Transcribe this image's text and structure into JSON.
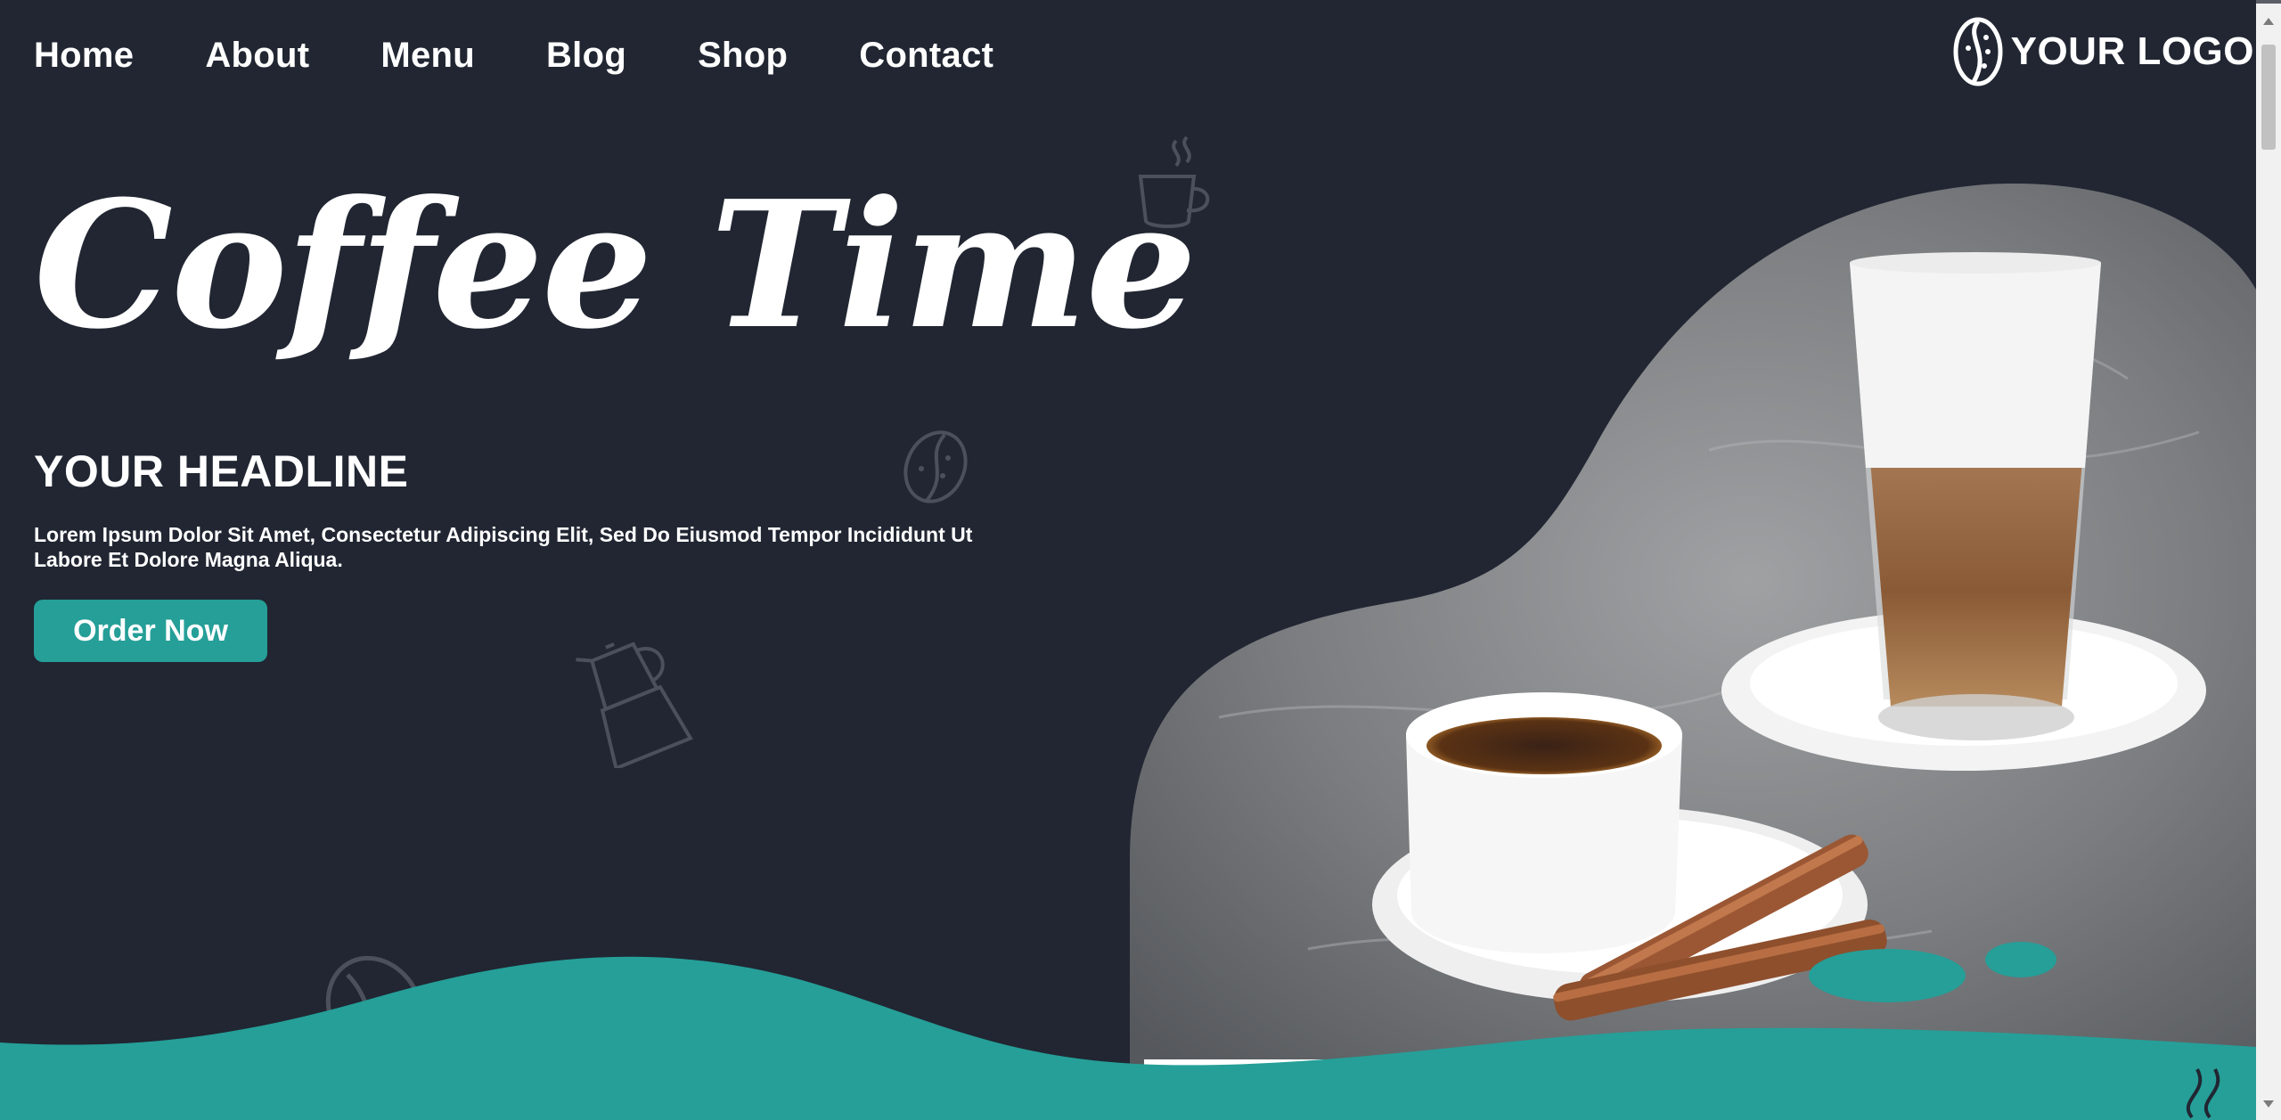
{
  "nav": {
    "items": [
      {
        "label": "Home"
      },
      {
        "label": "About"
      },
      {
        "label": "Menu"
      },
      {
        "label": "Blog"
      },
      {
        "label": "Shop"
      },
      {
        "label": "Contact"
      }
    ]
  },
  "logo": {
    "text": "YOUR LOGO"
  },
  "hero": {
    "title": "Coffee Time",
    "headline": "YOUR HEADLINE",
    "description": "Lorem Ipsum Dolor Sit Amet, Consectetur Adipiscing Elit, Sed Do Eiusmod Tempor Incididunt Ut Labore Et Dolore Magna Aliqua.",
    "cta_label": "Order Now"
  },
  "colors": {
    "background": "#212632",
    "accent": "#259f98",
    "text": "#ffffff",
    "doodle": "#4b505c"
  },
  "icons": [
    "coffee-cup-icon",
    "coffee-bean-icon",
    "moka-pot-icon",
    "coffee-bean-outline-icon",
    "steam-icon",
    "logo-bean-icon"
  ]
}
